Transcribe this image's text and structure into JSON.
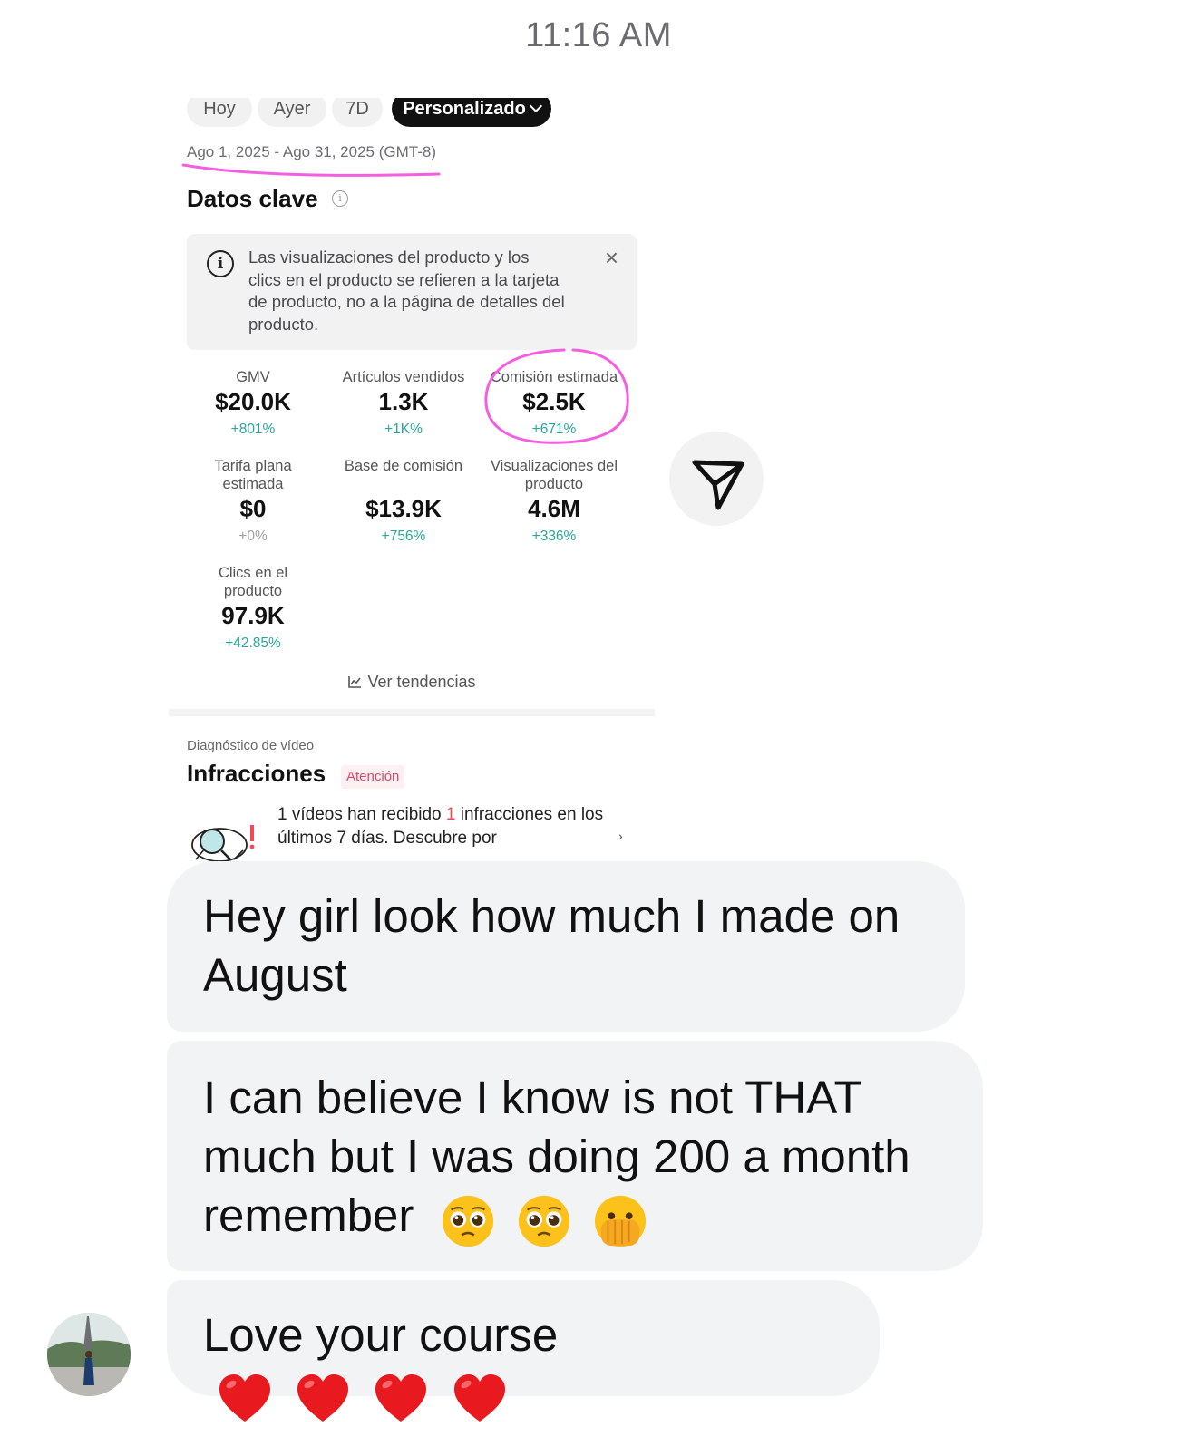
{
  "status_bar": {
    "time": "11:16 AM"
  },
  "screenshot": {
    "filters": [
      "Hoy",
      "Ayer",
      "7D",
      "Personalizado"
    ],
    "date_range": "Ago 1, 2025 - Ago 31, 2025 (GMT-8)",
    "section_title": "Datos clave",
    "notice_text": "Las visualizaciones del producto y los clics en el producto se refieren a la tarjeta de producto, no a la página de detalles del producto.",
    "metrics": [
      {
        "label": "GMV",
        "value": "$20.0K",
        "change": "+801%"
      },
      {
        "label": "Artículos vendidos",
        "value": "1.3K",
        "change": "+1K%"
      },
      {
        "label": "Comisión estimada",
        "value": "$2.5K",
        "change": "+671%"
      },
      {
        "label": "Tarifa plana estimada",
        "value": "$0",
        "change": "+0%"
      },
      {
        "label": "Base de comisión",
        "value": "$13.9K",
        "change": "+756%"
      },
      {
        "label": "Visualizaciones del producto",
        "value": "4.6M",
        "change": "+336%"
      },
      {
        "label": "Clics en el producto",
        "value": "97.9K",
        "change": "+42.85%"
      }
    ],
    "trends_link": "Ver tendencias",
    "diagnosis_label": "Diagnóstico de vídeo",
    "infractions_title": "Infracciones",
    "infractions_badge": "Atención",
    "infractions_text_a": "1 vídeos han recibido ",
    "infractions_count": "1",
    "infractions_text_b": " infracciones en los últimos 7 días. Descubre por",
    "highlight_color": "#f45fe0"
  },
  "messages": [
    {
      "text": "Hey girl look how much I made on August"
    },
    {
      "text": "I can believe I know is not THAT much but I was doing 200 a month remember",
      "emojis": [
        "pleading-face",
        "pleading-face",
        "face-with-hand-over-mouth"
      ]
    },
    {
      "text": "Love your course",
      "emojis": [
        "red-heart",
        "red-heart",
        "red-heart",
        "red-heart"
      ]
    }
  ],
  "colors": {
    "bubble": "#f2f3f5",
    "positive_change": "#2aa69a",
    "attention": "#e0466a"
  }
}
